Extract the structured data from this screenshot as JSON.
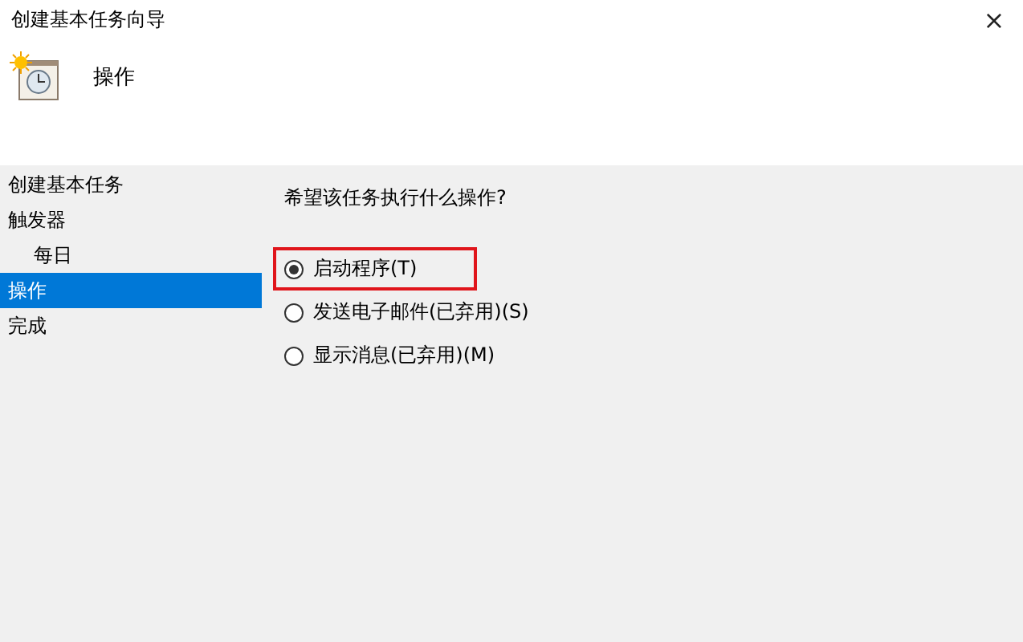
{
  "window": {
    "title": "创建基本任务向导",
    "close": "×"
  },
  "header": {
    "title": "操作"
  },
  "sidebar": {
    "items": [
      {
        "label": "创建基本任务",
        "selected": false
      },
      {
        "label": "触发器",
        "selected": false,
        "children": [
          {
            "label": "每日",
            "selected": false
          }
        ]
      },
      {
        "label": "操作",
        "selected": true
      },
      {
        "label": "完成",
        "selected": false
      }
    ]
  },
  "content": {
    "question": "希望该任务执行什么操作?",
    "options": [
      {
        "label": "启动程序(T)",
        "selected": true,
        "highlighted": true
      },
      {
        "label": "发送电子邮件(已弃用)(S)",
        "selected": false,
        "highlighted": false
      },
      {
        "label": "显示消息(已弃用)(M)",
        "selected": false,
        "highlighted": false
      }
    ]
  }
}
